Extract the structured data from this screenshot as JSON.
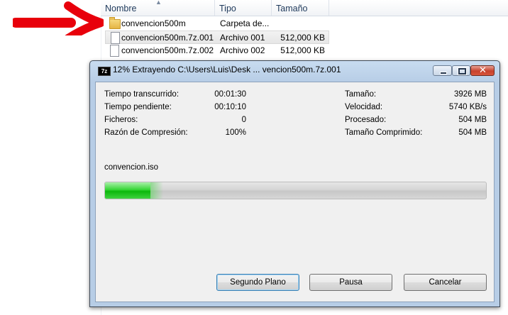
{
  "explorer": {
    "columns": {
      "name": "Nombre",
      "type": "Tipo",
      "size": "Tamaño"
    },
    "files": [
      {
        "name": "convencion500m",
        "type": "Carpeta de...",
        "size": "",
        "icon": "folder-icon"
      },
      {
        "name": "convencion500m.7z.001",
        "type": "Archivo 001",
        "size": "512,000 KB",
        "icon": "file-icon"
      },
      {
        "name": "convencion500m.7z.002",
        "type": "Archivo 002",
        "size": "512,000 KB",
        "icon": "file-icon"
      }
    ],
    "annotation_arrow_color": "#e8000b"
  },
  "dialog": {
    "app_icon": "7z",
    "title": "12% Extrayendo C:\\Users\\Luis\\Desk ... vencion500m.7z.001",
    "stats_left": [
      {
        "label": "Tiempo transcurrido:",
        "value": "00:01:30"
      },
      {
        "label": "Tiempo pendiente:",
        "value": "00:10:10"
      },
      {
        "label": "Ficheros:",
        "value": "0"
      },
      {
        "label": "Razón de Compresión:",
        "value": "100%"
      }
    ],
    "stats_right": [
      {
        "label": "Tamaño:",
        "value": "3926 MB"
      },
      {
        "label": "Velocidad:",
        "value": "5740 KB/s"
      },
      {
        "label": "Procesado:",
        "value": "504 MB"
      },
      {
        "label": "Tamaño Comprimido:",
        "value": "504 MB"
      }
    ],
    "current_file": "convencion.iso",
    "progress_percent": 12,
    "buttons": {
      "background": "Segundo Plano",
      "pause": "Pausa",
      "cancel": "Cancelar"
    }
  }
}
